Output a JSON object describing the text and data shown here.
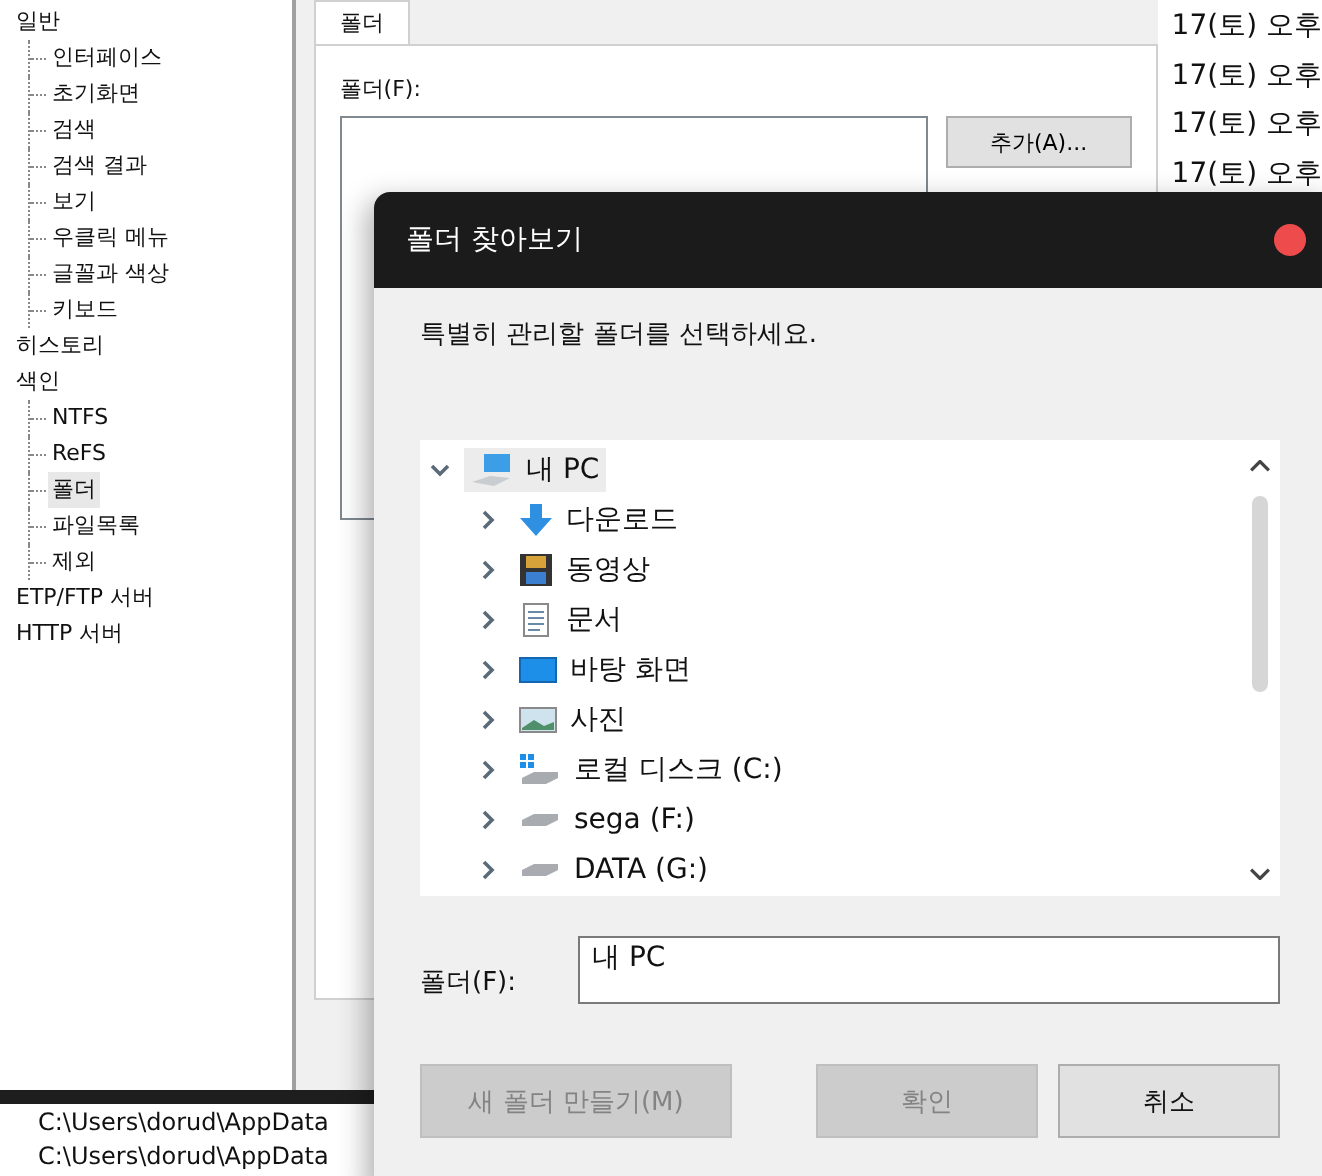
{
  "settings_tree": {
    "items": [
      {
        "label": "일반",
        "selected": false,
        "children": [
          {
            "label": "인터페이스",
            "selected": false
          },
          {
            "label": "초기화면",
            "selected": false
          },
          {
            "label": "검색",
            "selected": false
          },
          {
            "label": "검색 결과",
            "selected": false
          },
          {
            "label": "보기",
            "selected": false
          },
          {
            "label": "우클릭 메뉴",
            "selected": false
          },
          {
            "label": "글꼴과 색상",
            "selected": false
          },
          {
            "label": "키보드",
            "selected": false
          }
        ]
      },
      {
        "label": "히스토리",
        "selected": false
      },
      {
        "label": "색인",
        "selected": false,
        "children": [
          {
            "label": "NTFS",
            "selected": false
          },
          {
            "label": "ReFS",
            "selected": false
          },
          {
            "label": "폴더",
            "selected": true
          },
          {
            "label": "파일목록",
            "selected": false
          },
          {
            "label": "제외",
            "selected": false
          }
        ]
      },
      {
        "label": "ETP/FTP 서버",
        "selected": false
      },
      {
        "label": "HTTP 서버",
        "selected": false
      }
    ]
  },
  "folder_page": {
    "tab": {
      "label": "폴더",
      "selected": true
    },
    "folder_label": "폴더(F):",
    "add_button": "추가(A)..."
  },
  "date_column": [
    "17(토) 오후",
    "17(토) 오후",
    "17(토) 오후",
    "17(토) 오후"
  ],
  "path_list": [
    "C:\\Users\\dorud\\AppData",
    "C:\\Users\\dorud\\AppData"
  ],
  "dialog": {
    "title": "폴더 찾아보기",
    "instruction": "특별히 관리할 폴더를 선택하세요.",
    "tree": [
      {
        "label": "내 PC",
        "kind": "pc",
        "expanded": true,
        "selected": true,
        "children": [
          {
            "label": "다운로드",
            "kind": "download",
            "expanded": false,
            "selected": false
          },
          {
            "label": "동영상",
            "kind": "video",
            "expanded": false,
            "selected": false
          },
          {
            "label": "문서",
            "kind": "document",
            "expanded": false,
            "selected": false
          },
          {
            "label": "바탕 화면",
            "kind": "desktop",
            "expanded": false,
            "selected": false
          },
          {
            "label": "사진",
            "kind": "pictures",
            "expanded": false,
            "selected": false
          },
          {
            "label": "로컬 디스크 (C:)",
            "kind": "system-drive",
            "expanded": false,
            "selected": false
          },
          {
            "label": "sega (F:)",
            "kind": "drive",
            "expanded": false,
            "selected": false
          },
          {
            "label": "DATA (G:)",
            "kind": "drive",
            "expanded": false,
            "selected": false
          }
        ]
      }
    ],
    "folder_label": "폴더(F):",
    "folder_value": "내 PC",
    "buttons": [
      {
        "label": "새 폴더 만들기(M)",
        "disabled": true
      },
      {
        "label": "확인",
        "disabled": true
      },
      {
        "label": "취소",
        "disabled": false
      }
    ]
  }
}
